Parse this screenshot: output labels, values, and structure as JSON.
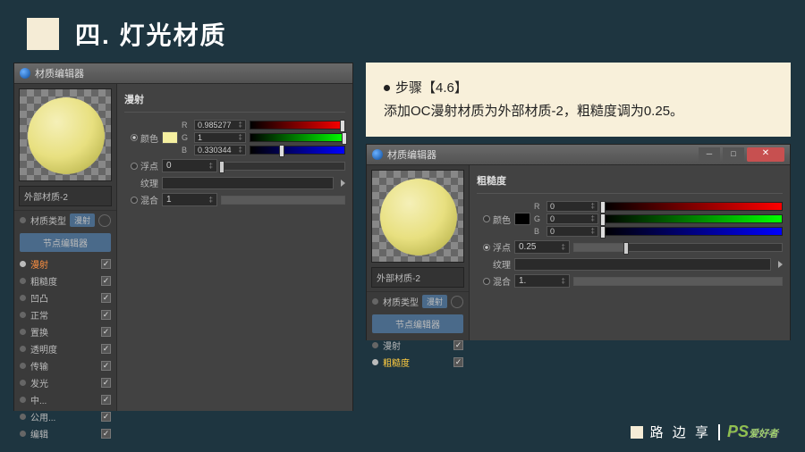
{
  "header": {
    "title": "四. 灯光材质"
  },
  "info": {
    "step": "步骤【4.6】",
    "text": "添加OC漫射材质为外部材质-2，粗糙度调为0.25。"
  },
  "panel_left": {
    "title": "材质编辑器",
    "mat_name": "外部材质-2",
    "type_label": "材质类型",
    "type_value": "漫射",
    "node_btn": "节点编辑器",
    "section": "漫射",
    "color_lbl": "颜色",
    "float_lbl": "浮点",
    "float_val": "0",
    "tex_lbl": "纹理",
    "mix_lbl": "混合",
    "mix_val": "1",
    "rgb": {
      "r": {
        "lbl": "R",
        "val": "0.985277",
        "pos": 98
      },
      "g": {
        "lbl": "G",
        "val": "1",
        "pos": 100
      },
      "b": {
        "lbl": "B",
        "val": "0.330344",
        "pos": 33
      }
    },
    "checks": [
      {
        "label": "漫射",
        "checked": true,
        "sel": true
      },
      {
        "label": "粗糙度",
        "checked": true
      },
      {
        "label": "凹凸",
        "checked": true
      },
      {
        "label": "正常",
        "checked": true
      },
      {
        "label": "置换",
        "checked": true
      },
      {
        "label": "透明度",
        "checked": true
      },
      {
        "label": "传输",
        "checked": true
      },
      {
        "label": "发光",
        "checked": true
      },
      {
        "label": "中...",
        "checked": true
      },
      {
        "label": "公用...",
        "checked": true
      },
      {
        "label": "编辑",
        "checked": true
      }
    ]
  },
  "panel_right": {
    "title": "材质编辑器",
    "mat_name": "外部材质-2",
    "type_label": "材质类型",
    "type_value": "漫射",
    "node_btn": "节点编辑器",
    "section": "粗糙度",
    "color_lbl": "颜色",
    "float_lbl": "浮点",
    "float_val": "0.25",
    "tex_lbl": "纹理",
    "mix_lbl": "混合",
    "mix_val": "1.",
    "rgb": {
      "r": {
        "lbl": "R",
        "val": "0",
        "pos": 0
      },
      "g": {
        "lbl": "G",
        "val": "0",
        "pos": 0
      },
      "b": {
        "lbl": "B",
        "val": "0",
        "pos": 0
      }
    },
    "checks": [
      {
        "label": "漫射",
        "checked": true
      },
      {
        "label": "粗糙度",
        "checked": true,
        "sel2": true
      }
    ]
  },
  "footer": {
    "text": "路 边 享"
  }
}
